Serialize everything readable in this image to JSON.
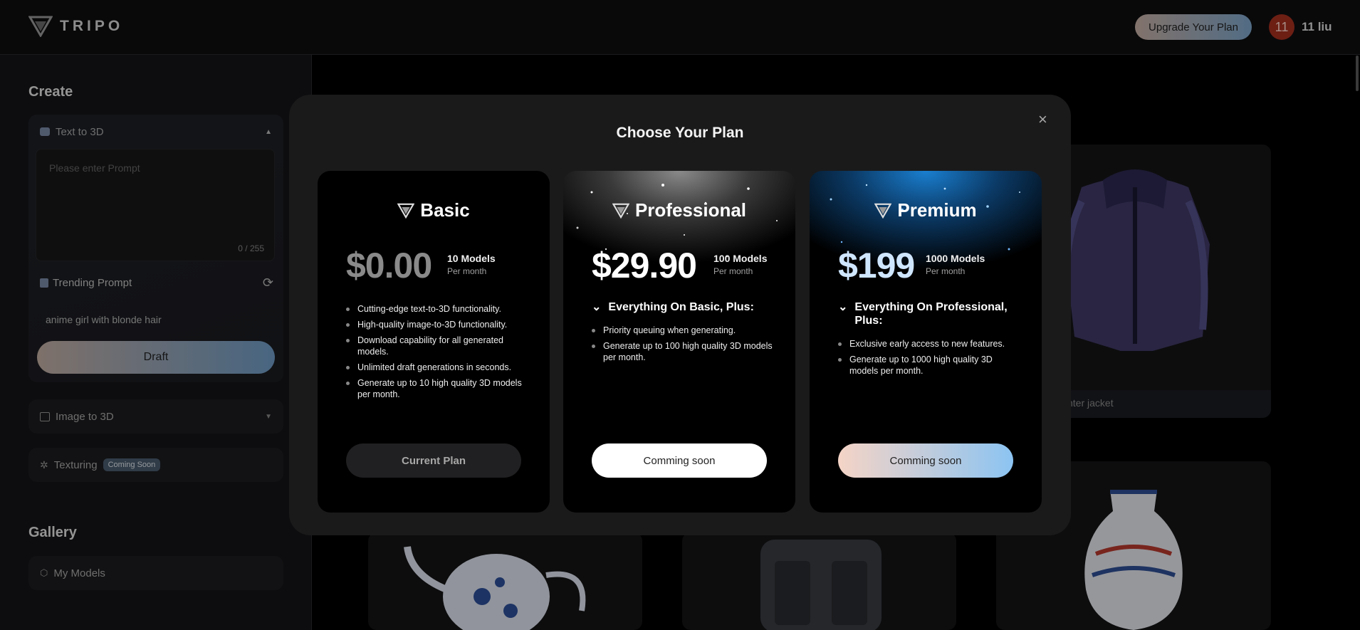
{
  "header": {
    "logo_text": "TRIPO",
    "upgrade_label": "Upgrade Your Plan",
    "avatar_text": "11",
    "username": "11 liu"
  },
  "sidebar": {
    "create_title": "Create",
    "text_to_3d": {
      "label": "Text to 3D",
      "placeholder": "Please enter Prompt",
      "counter": "0 / 255",
      "trending_label": "Trending Prompt",
      "trending_text": "anime girl with blonde hair",
      "draft_label": "Draft"
    },
    "image_to_3d_label": "Image to 3D",
    "texturing_label": "Texturing",
    "texturing_badge": "Coming Soon",
    "gallery_title": "Gallery",
    "my_models_label": "My Models"
  },
  "background": {
    "jacket_label": "nter jacket"
  },
  "modal": {
    "title": "Choose Your Plan",
    "close": "×",
    "plans": [
      {
        "name": "Basic",
        "price": "$0.00",
        "models": "10 Models",
        "period": "Per month",
        "features": [
          "Cutting-edge text-to-3D functionality.",
          "High-quality image-to-3D functionality.",
          "Download capability for all generated models.",
          "Unlimited draft generations in seconds.",
          "Generate up to 10 high quality 3D models per month."
        ],
        "button": "Current Plan"
      },
      {
        "name": "Professional",
        "price": "$29.90",
        "models": "100 Models",
        "period": "Per month",
        "plus_heading": "Everything On Basic, Plus:",
        "features": [
          "Priority queuing when generating.",
          "Generate up to 100 high quality 3D models per month."
        ],
        "button": "Comming soon"
      },
      {
        "name": "Premium",
        "price": "$199",
        "models": "1000 Models",
        "period": "Per month",
        "plus_heading": "Everything On Professional, Plus:",
        "features": [
          "Exclusive early access to new features.",
          "Generate up to 1000 high quality 3D models per month."
        ],
        "button": "Comming soon"
      }
    ]
  },
  "colors": {
    "accent_gradient_start": "#c2aea4",
    "accent_gradient_end": "#6f9cc6",
    "premium_price": "#cfe6ff",
    "avatar_bg": "#a8301f"
  }
}
